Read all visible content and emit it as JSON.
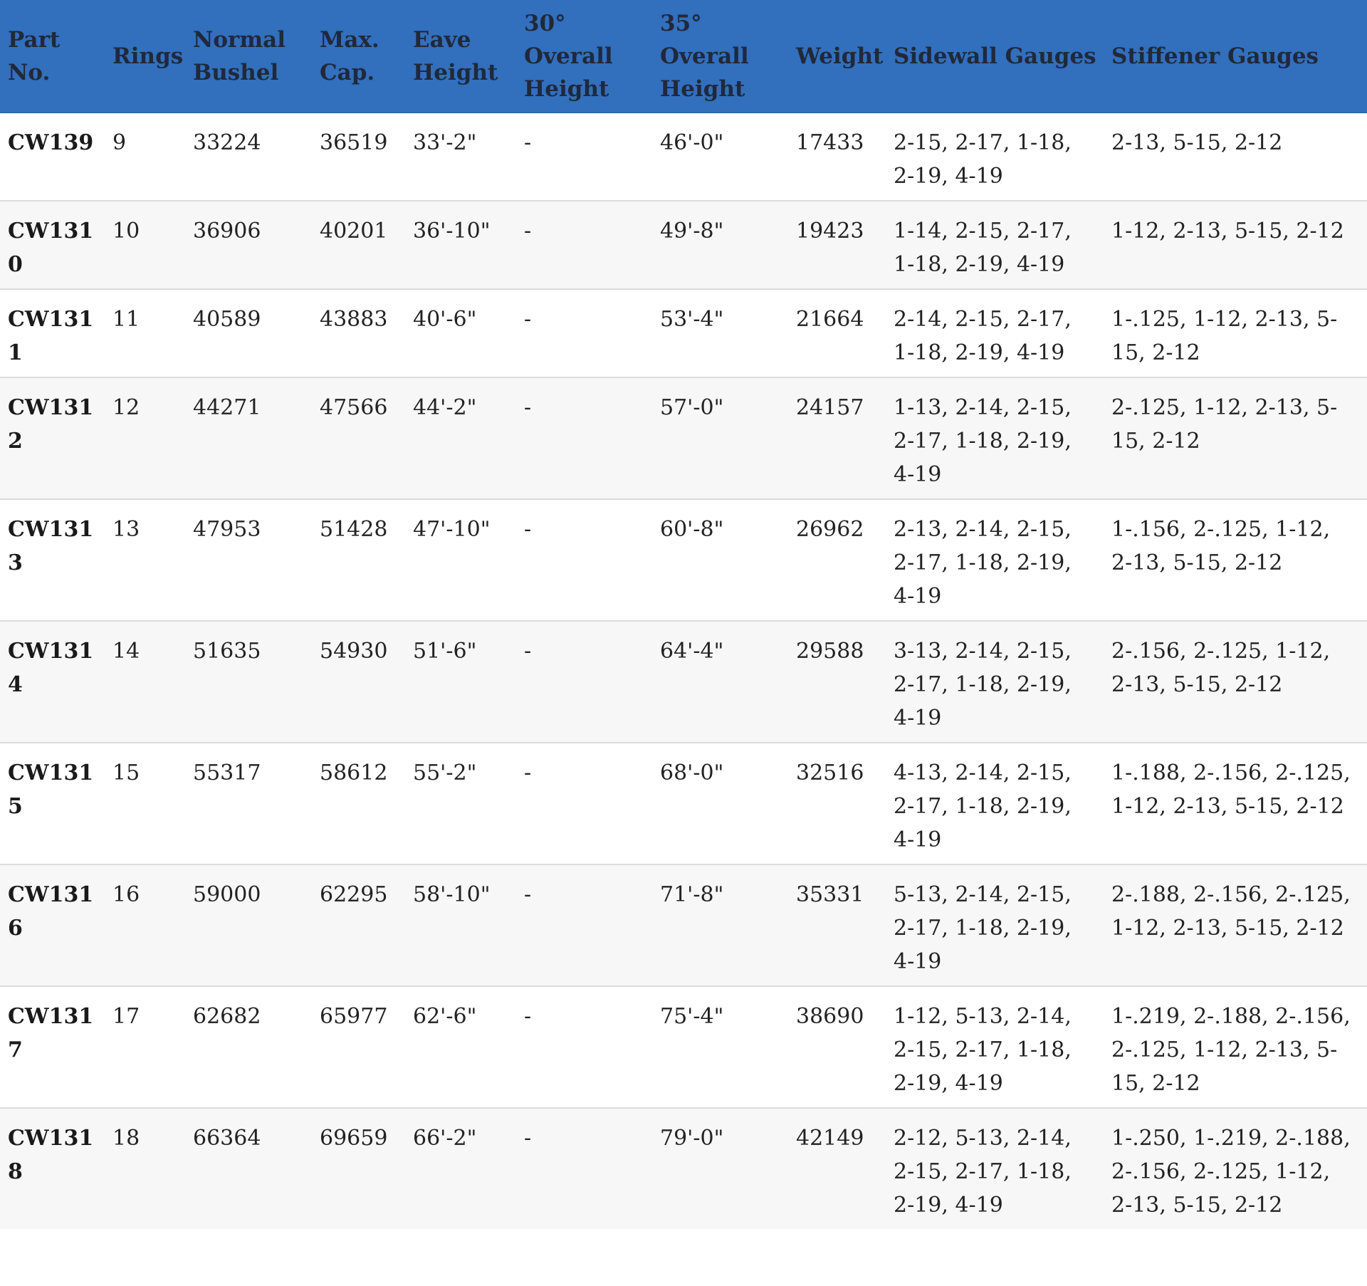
{
  "table": {
    "headers": [
      "Part No.",
      "Rings",
      "Normal Bushel",
      "Max. Cap.",
      "Eave Height",
      "30° Overall Height",
      "35° Overall Height",
      "Weight",
      "Sidewall Gauges",
      "Stiffener Gauges"
    ],
    "rows": [
      [
        "CW139",
        "9",
        "33224",
        "36519",
        "33'-2\"",
        "-",
        "46'-0\"",
        "17433",
        "2-15, 2-17, 1-18, 2-19, 4-19",
        "2-13, 5-15, 2-12"
      ],
      [
        "CW1310",
        "10",
        "36906",
        "40201",
        "36'-10\"",
        "-",
        "49'-8\"",
        "19423",
        "1-14, 2-15, 2-17, 1-18, 2-19, 4-19",
        "1-12, 2-13, 5-15, 2-12"
      ],
      [
        "CW1311",
        "11",
        "40589",
        "43883",
        "40'-6\"",
        "-",
        "53'-4\"",
        "21664",
        "2-14, 2-15, 2-17, 1-18, 2-19, 4-19",
        "1-.125, 1-12, 2-13, 5-15, 2-12"
      ],
      [
        "CW1312",
        "12",
        "44271",
        "47566",
        "44'-2\"",
        "-",
        "57'-0\"",
        "24157",
        "1-13, 2-14, 2-15, 2-17, 1-18, 2-19, 4-19",
        "2-.125, 1-12, 2-13, 5-15, 2-12"
      ],
      [
        "CW1313",
        "13",
        "47953",
        "51428",
        "47'-10\"",
        "-",
        "60'-8\"",
        "26962",
        "2-13, 2-14, 2-15, 2-17, 1-18, 2-19, 4-19",
        "1-.156, 2-.125, 1-12, 2-13, 5-15, 2-12"
      ],
      [
        "CW1314",
        "14",
        "51635",
        "54930",
        "51'-6\"",
        "-",
        "64'-4\"",
        "29588",
        "3-13, 2-14, 2-15, 2-17, 1-18, 2-19, 4-19",
        "2-.156, 2-.125, 1-12, 2-13, 5-15, 2-12"
      ],
      [
        "CW1315",
        "15",
        "55317",
        "58612",
        "55'-2\"",
        "-",
        "68'-0\"",
        "32516",
        "4-13, 2-14, 2-15, 2-17, 1-18, 2-19, 4-19",
        "1-.188, 2-.156, 2-.125, 1-12, 2-13, 5-15, 2-12"
      ],
      [
        "CW1316",
        "16",
        "59000",
        "62295",
        "58'-10\"",
        "-",
        "71'-8\"",
        "35331",
        "5-13, 2-14, 2-15, 2-17, 1-18, 2-19, 4-19",
        "2-.188, 2-.156, 2-.125, 1-12, 2-13, 5-15, 2-12"
      ],
      [
        "CW1317",
        "17",
        "62682",
        "65977",
        "62'-6\"",
        "-",
        "75'-4\"",
        "38690",
        "1-12, 5-13, 2-14, 2-15, 2-17, 1-18, 2-19, 4-19",
        "1-.219, 2-.188, 2-.156, 2-.125, 1-12, 2-13, 5-15, 2-12"
      ],
      [
        "CW1318",
        "18",
        "66364",
        "69659",
        "66'-2\"",
        "-",
        "79'-0\"",
        "42149",
        "2-12, 5-13, 2-14, 2-15, 2-17, 1-18, 2-19, 4-19",
        "1-.250, 1-.219, 2-.188, 2-.156, 2-.125, 1-12, 2-13, 5-15, 2-12"
      ]
    ]
  },
  "colors": {
    "header_background": "#326fbd",
    "header_text": "#20293a",
    "stripe": "#f7f7f7"
  }
}
